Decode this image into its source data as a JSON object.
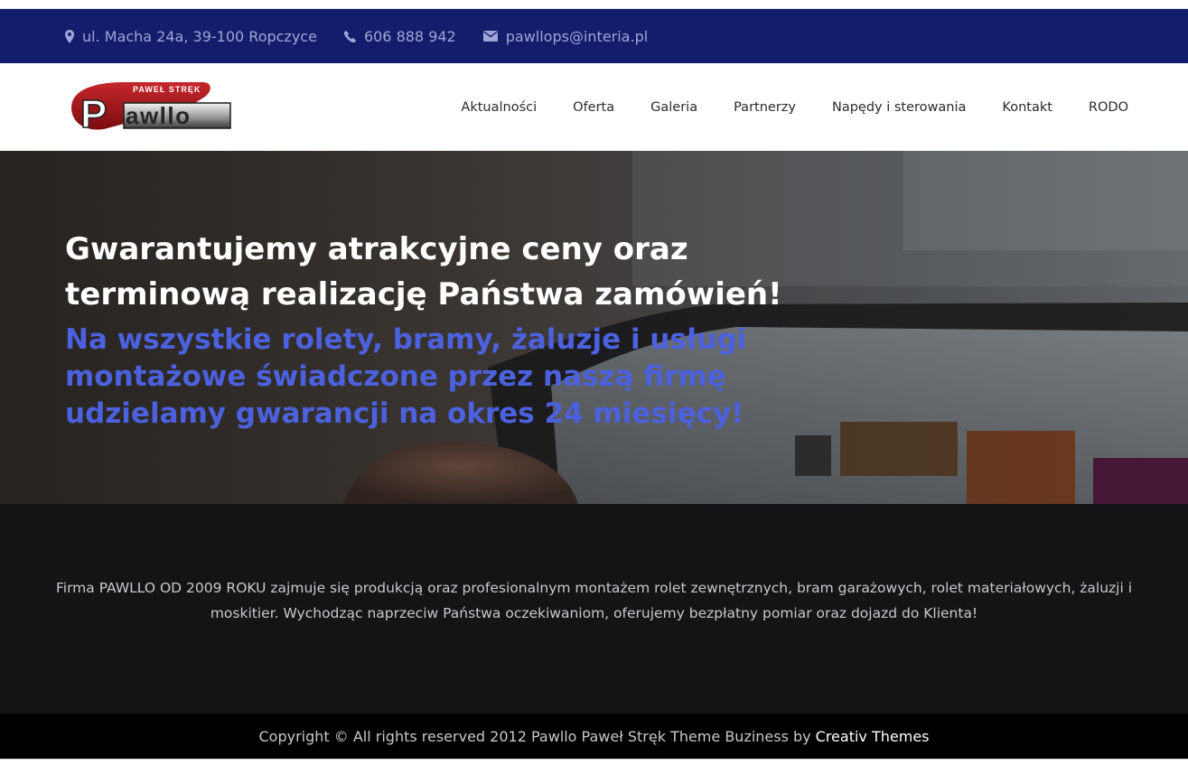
{
  "topbar": {
    "address": "ul. Macha 24a, 39-100 Ropczyce",
    "phone": "606 888 942",
    "email": "pawllops@interia.pl",
    "icons": [
      "map-marker-icon",
      "phone-icon",
      "envelope-icon"
    ],
    "background": "#131d6b",
    "text_color": "#9ea6d6"
  },
  "header": {
    "logo": {
      "owner_text": "PAWEŁ STRĘK",
      "brand_text": "Pawllo"
    }
  },
  "nav": {
    "items": [
      "Aktualności",
      "Oferta",
      "Galeria",
      "Partnerzy",
      "Napędy i sterowania",
      "Kontakt",
      "RODO"
    ]
  },
  "hero": {
    "title": "Gwarantujemy atrakcyjne ceny oraz terminową realizację Państwa zamówień!",
    "subtitle": "Na wszystkie rolety, bramy, żaluzje i usługi montażowe świadczone przez naszą firmę udzielamy gwarancji na okres 24 miesięcy!",
    "subtitle_color": "#4c61dd"
  },
  "about": {
    "text": "Firma PAWLLO OD 2009 ROKU zajmuje się produkcją oraz profesionalnym montażem rolet zewnętrznych, bram garażowych, rolet materiałowych, żaluzji i moskitier. Wychodząc naprzeciw Państwa oczekiwaniom, oferujemy bezpłatny pomiar oraz dojazd do Klienta!"
  },
  "footer": {
    "copyright": "Copyright © All rights reserved 2012 Pawllo Paweł Stręk Theme Buziness by",
    "link": "Creativ Themes"
  }
}
